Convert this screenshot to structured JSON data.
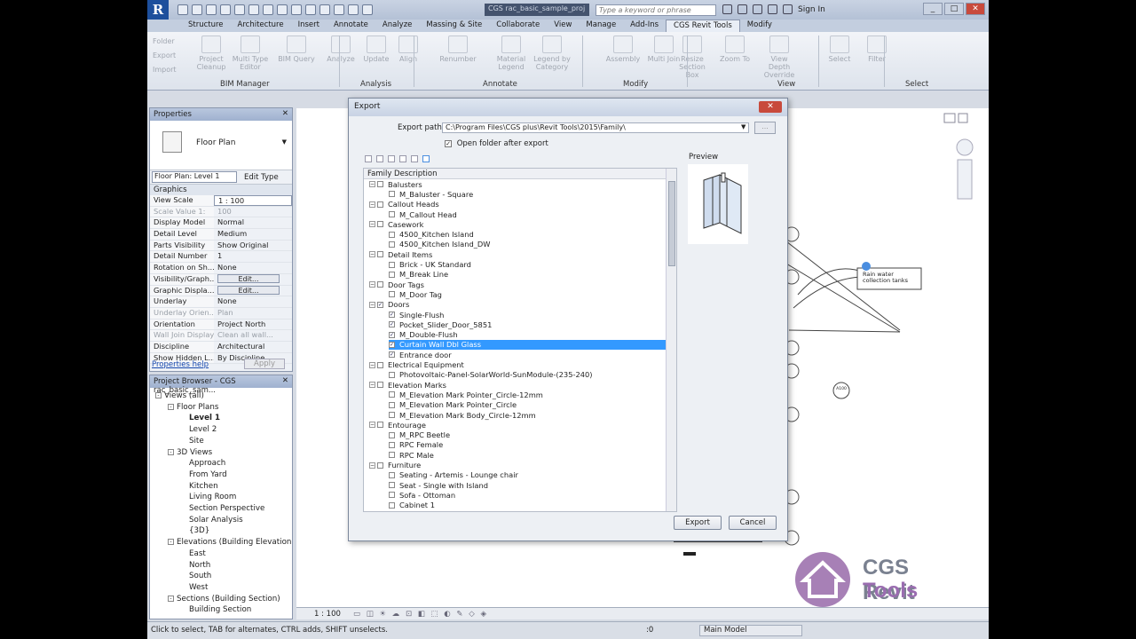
{
  "titlebar": {
    "document_title": "CGS rac_basic_sample_proj",
    "search_placeholder": "Type a keyword or phrase",
    "sign_in": "Sign In"
  },
  "ribbon_tabs": [
    "Structure",
    "Architecture",
    "Insert",
    "Annotate",
    "Analyze",
    "Massing & Site",
    "Collaborate",
    "View",
    "Manage",
    "Add-Ins",
    "CGS Revit Tools",
    "Modify"
  ],
  "ribbon": {
    "small_buttons": [
      "Folder",
      "Export",
      "Import"
    ],
    "buttons": [
      "Project Cleanup",
      "Multi Type Editor",
      "BIM Query",
      "Analyze",
      "Update",
      "Align",
      "Renumber",
      "Material Legend",
      "Legend by Category",
      "Assembly",
      "Multi Join",
      "Resize Section Box",
      "Zoom To",
      "View Depth Override",
      "Select",
      "Filter"
    ],
    "panels": [
      "BIM Manager",
      "Analysis",
      "Annotate",
      "Modify",
      "View",
      "Select"
    ]
  },
  "properties": {
    "title": "Properties",
    "type_name": "Floor Plan",
    "instance_filter": "Floor Plan: Level 1",
    "edit_type": "Edit Type",
    "group": "Graphics",
    "rows": [
      {
        "k": "View Scale",
        "v": "1 : 100"
      },
      {
        "k": "Scale Value  1:",
        "v": "100"
      },
      {
        "k": "Display Model",
        "v": "Normal"
      },
      {
        "k": "Detail Level",
        "v": "Medium"
      },
      {
        "k": "Parts Visibility",
        "v": "Show Original"
      },
      {
        "k": "Detail Number",
        "v": "1"
      },
      {
        "k": "Rotation on Sh...",
        "v": "None"
      },
      {
        "k": "Visibility/Graph...",
        "v": "Edit..."
      },
      {
        "k": "Graphic Displa...",
        "v": "Edit..."
      },
      {
        "k": "Underlay",
        "v": "None"
      },
      {
        "k": "Underlay Orien...",
        "v": "Plan"
      },
      {
        "k": "Orientation",
        "v": "Project North"
      },
      {
        "k": "Wall Join Display",
        "v": "Clean all wall..."
      },
      {
        "k": "Discipline",
        "v": "Architectural"
      },
      {
        "k": "Show Hidden L...",
        "v": "By Discipline"
      }
    ],
    "help": "Properties help",
    "apply": "Apply"
  },
  "project_browser": {
    "title": "Project Browser - CGS rac_basic_sam...",
    "items": [
      {
        "t": "Views (all)",
        "lvl": 0,
        "ex": "-"
      },
      {
        "t": "Floor Plans",
        "lvl": 1,
        "ex": "-"
      },
      {
        "t": "Level 1",
        "lvl": 2,
        "bold": true
      },
      {
        "t": "Level 2",
        "lvl": 2
      },
      {
        "t": "Site",
        "lvl": 2
      },
      {
        "t": "3D Views",
        "lvl": 1,
        "ex": "-"
      },
      {
        "t": "Approach",
        "lvl": 2
      },
      {
        "t": "From Yard",
        "lvl": 2
      },
      {
        "t": "Kitchen",
        "lvl": 2
      },
      {
        "t": "Living Room",
        "lvl": 2
      },
      {
        "t": "Section Perspective",
        "lvl": 2
      },
      {
        "t": "Solar Analysis",
        "lvl": 2
      },
      {
        "t": "{3D}",
        "lvl": 2
      },
      {
        "t": "Elevations (Building Elevation",
        "lvl": 1,
        "ex": "-"
      },
      {
        "t": "East",
        "lvl": 2
      },
      {
        "t": "North",
        "lvl": 2
      },
      {
        "t": "South",
        "lvl": 2
      },
      {
        "t": "West",
        "lvl": 2
      },
      {
        "t": "Sections (Building Section)",
        "lvl": 1,
        "ex": "-"
      },
      {
        "t": "Building Section",
        "lvl": 2
      }
    ]
  },
  "export_dialog": {
    "title": "Export",
    "export_path_label": "Export path:",
    "export_path": "C:\\Program Files\\CGS plus\\Revit Tools\\2015\\Family\\",
    "browse": "...",
    "open_folder_label": "Open folder after export",
    "column_header": "Family Description",
    "preview_label": "Preview",
    "export_button": "Export",
    "cancel_button": "Cancel",
    "tree": [
      {
        "t": "Balusters",
        "cat": true,
        "checked": false
      },
      {
        "t": "M_Baluster - Square",
        "checked": false
      },
      {
        "t": "Callout Heads",
        "cat": true,
        "checked": false
      },
      {
        "t": "M_Callout Head",
        "checked": false
      },
      {
        "t": "Casework",
        "cat": true,
        "checked": false
      },
      {
        "t": "4500_Kitchen Island",
        "checked": false
      },
      {
        "t": "4500_Kitchen Island_DW",
        "checked": false
      },
      {
        "t": "Detail Items",
        "cat": true,
        "checked": false
      },
      {
        "t": "Brick - UK Standard",
        "checked": false
      },
      {
        "t": "M_Break Line",
        "checked": false
      },
      {
        "t": "Door Tags",
        "cat": true,
        "checked": false
      },
      {
        "t": "M_Door Tag",
        "checked": false
      },
      {
        "t": "Doors",
        "cat": true,
        "checked": true
      },
      {
        "t": "Single-Flush",
        "checked": true
      },
      {
        "t": "Pocket_Slider_Door_5851",
        "checked": true
      },
      {
        "t": "M_Double-Flush",
        "checked": true
      },
      {
        "t": "Curtain Wall Dbl Glass",
        "checked": true,
        "selected": true
      },
      {
        "t": "Entrance door",
        "checked": true
      },
      {
        "t": "Electrical Equipment",
        "cat": true,
        "checked": false
      },
      {
        "t": "Photovoltaic-Panel-SolarWorld-SunModule-(235-240)",
        "checked": false
      },
      {
        "t": "Elevation Marks",
        "cat": true,
        "checked": false
      },
      {
        "t": "M_Elevation Mark Pointer_Circle-12mm",
        "checked": false
      },
      {
        "t": "M_Elevation Mark Pointer_Circle",
        "checked": false
      },
      {
        "t": "M_Elevation Mark Body_Circle-12mm",
        "checked": false
      },
      {
        "t": "Entourage",
        "cat": true,
        "checked": false
      },
      {
        "t": "M_RPC Beetle",
        "checked": false
      },
      {
        "t": "RPC Female",
        "checked": false
      },
      {
        "t": "RPC Male",
        "checked": false
      },
      {
        "t": "Furniture",
        "cat": true,
        "checked": false
      },
      {
        "t": "Seating - Artemis - Lounge chair",
        "checked": false
      },
      {
        "t": "Seat - Single with Island",
        "checked": false
      },
      {
        "t": "Sofa - Ottoman",
        "checked": false
      },
      {
        "t": "Cabinet 1",
        "checked": false
      }
    ]
  },
  "canvas": {
    "annotation": "Rain water collection tanks",
    "tag": "A100"
  },
  "viewbar": {
    "scale": "1 : 100"
  },
  "statusbar": {
    "hint": "Click to select, TAB for alternates, CTRL adds, SHIFT unselects.",
    "coord": ":0",
    "model": "Main Model"
  },
  "watermark": {
    "line1": "CGS Revit",
    "line2": "Tools"
  }
}
